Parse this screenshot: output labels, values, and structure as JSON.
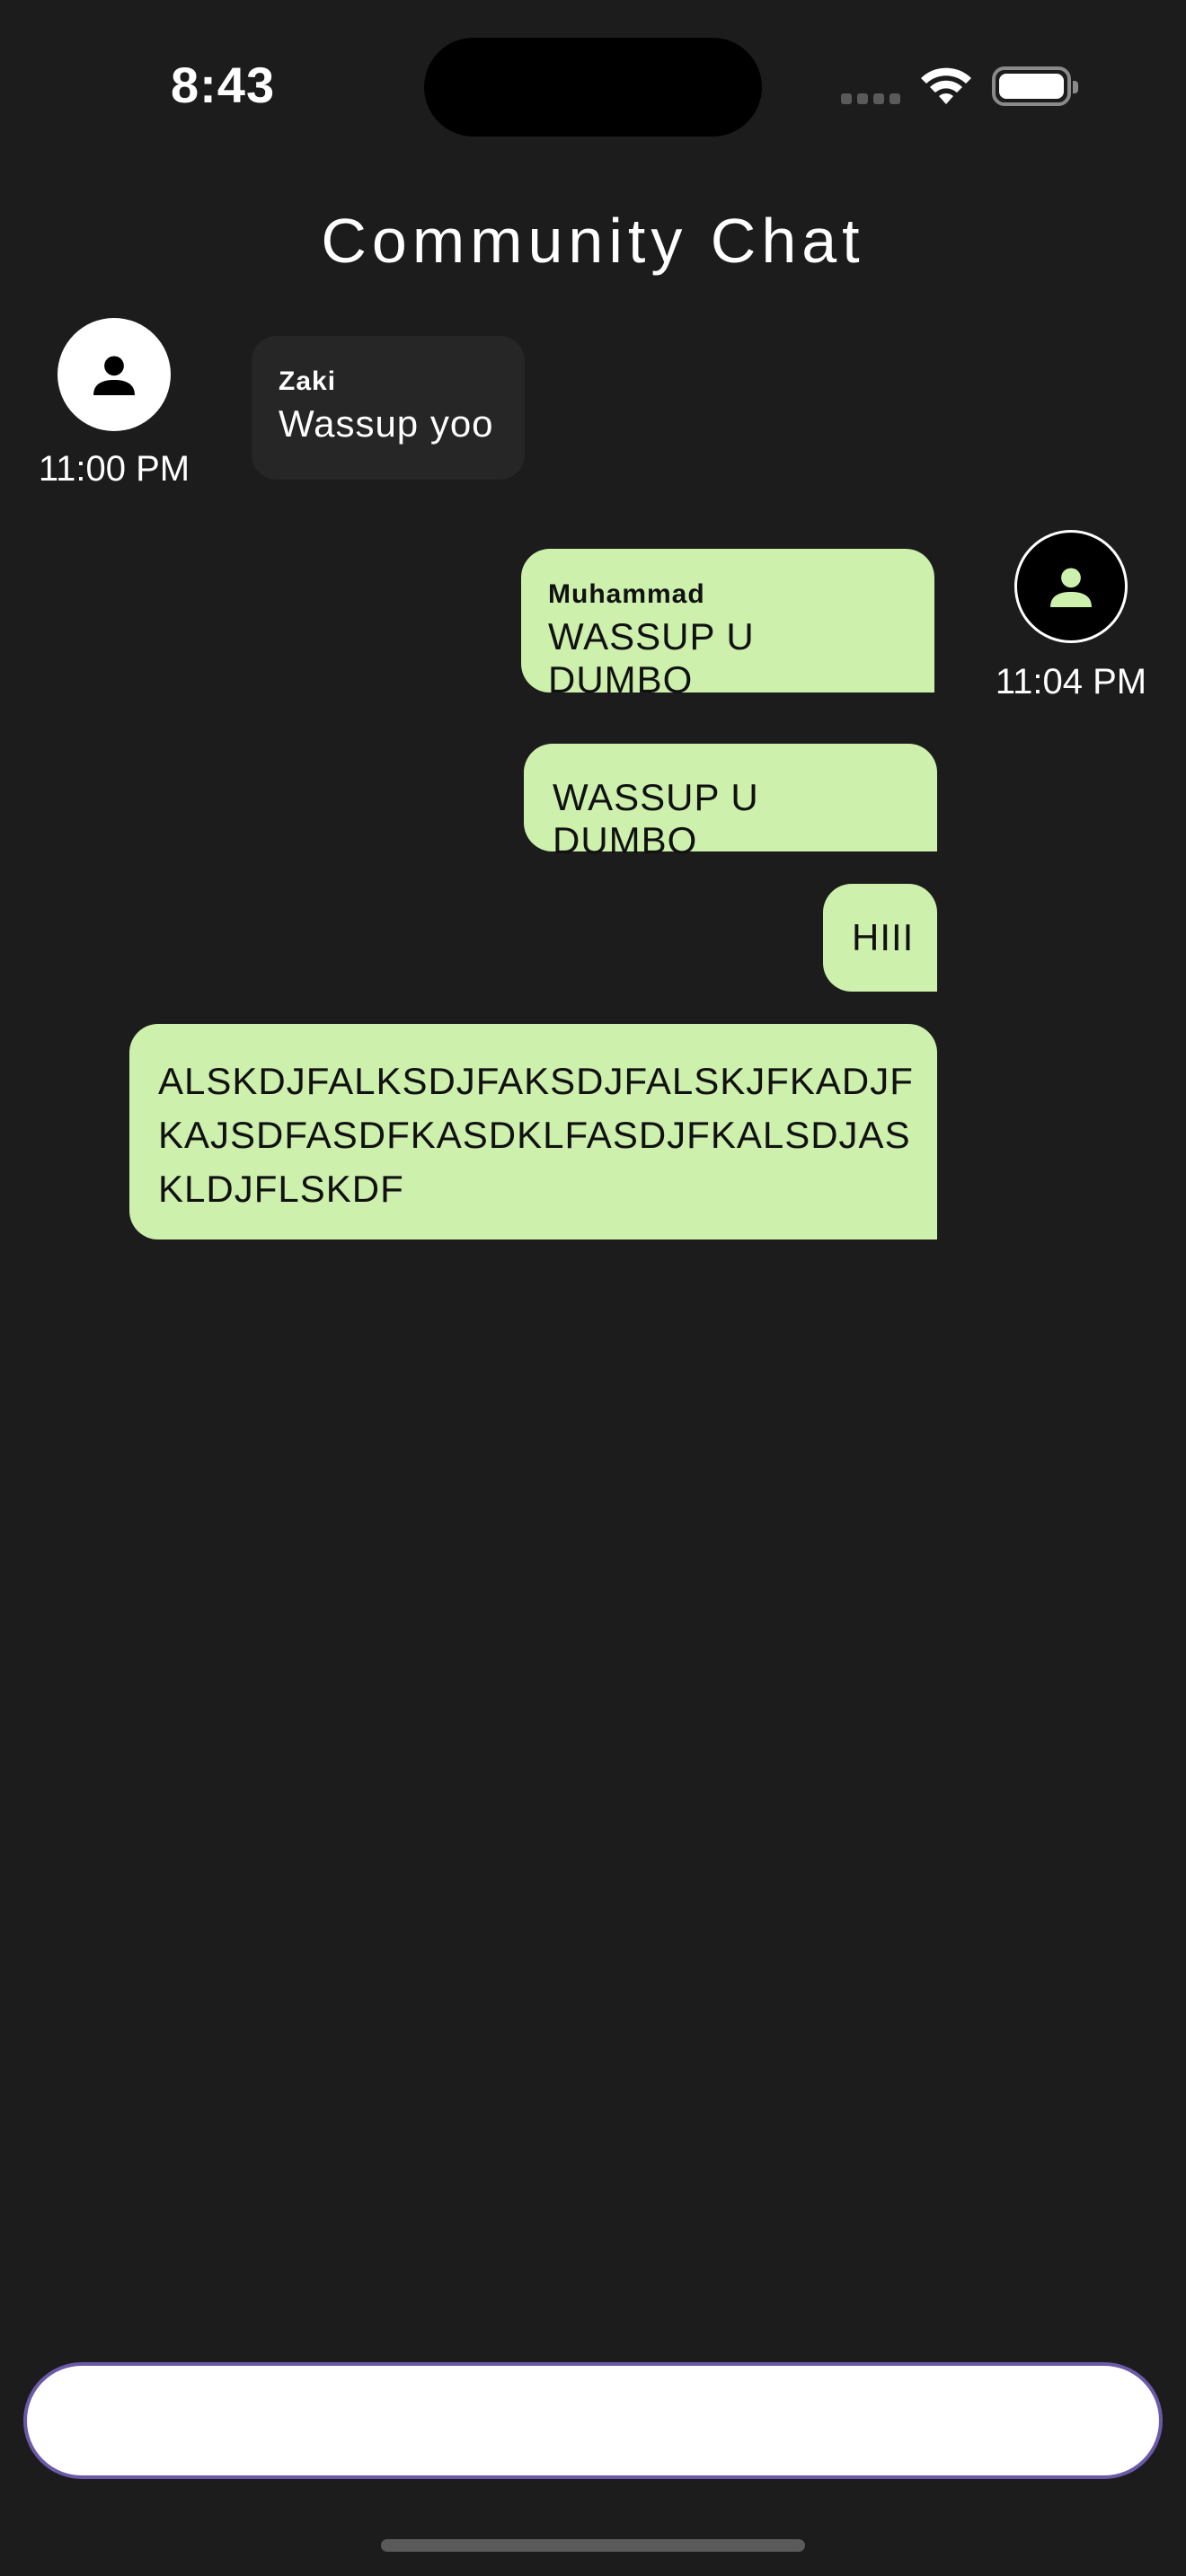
{
  "status_bar": {
    "time": "8:43"
  },
  "header": {
    "title": "Community Chat"
  },
  "messages": [
    {
      "direction": "incoming",
      "sender": "Zaki",
      "text": "Wassup yoo",
      "time": "11:00 PM"
    },
    {
      "direction": "outgoing",
      "sender": "Muhammad",
      "text": "WASSUP U DUMBO",
      "time": "11:04 PM"
    },
    {
      "direction": "outgoing",
      "sender": "",
      "text": "WASSUP U DUMBO",
      "time": ""
    },
    {
      "direction": "outgoing",
      "sender": "",
      "text": "HIII",
      "time": ""
    },
    {
      "direction": "outgoing",
      "sender": "",
      "text": "ALSKDJFALKSDJFAKSDJFALSKJFKADJFKAJSDFASDFKASDKLFASDJFKALSDJASKLDJFLSKDF",
      "time": "",
      "lines": [
        "ALSKDJFALKSDJFAKSDJFALSKJFKADJF",
        "KAJSDFASDFKASDKLFASDJFKALSDJAS",
        "KLDJFLSKDF"
      ]
    }
  ],
  "composer": {
    "placeholder": "",
    "value": ""
  },
  "icons": {
    "avatar": "person-icon",
    "wifi": "wifi-icon",
    "battery": "battery-icon"
  },
  "colors": {
    "background": "#1c1c1c",
    "outgoing_bubble": "#cdf0ad",
    "incoming_bubble": "#262626",
    "input_border": "#6b5aa8"
  }
}
